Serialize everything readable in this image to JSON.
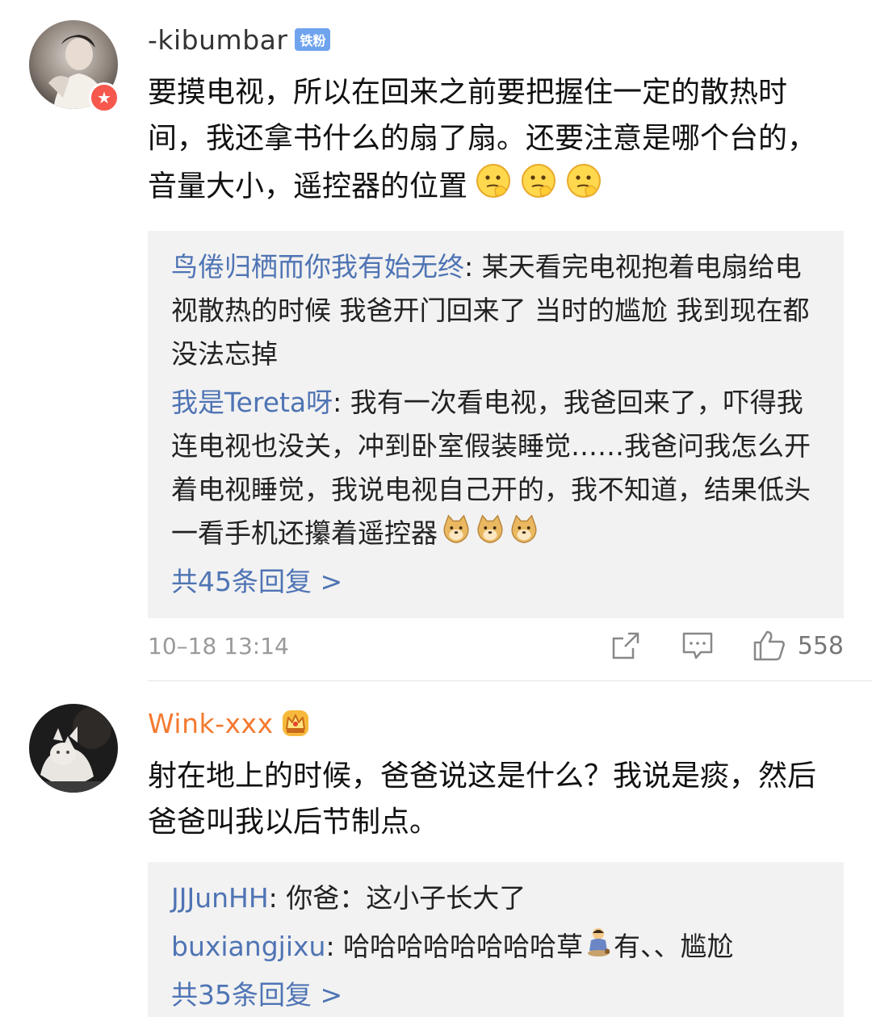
{
  "comments": [
    {
      "username": "-kibumbar",
      "fan_badge": "铁粉",
      "avatar_icon": "avatar-photo-woman",
      "badge_icon": "vip-star-icon",
      "text": "要摸电视，所以在回来之前要把握住一定的散热时间，我还拿书什么的扇了扇。还要注意是哪个台的，音量大小，遥控器的位置",
      "text_emoji": "thinking-face-emoji",
      "replies": [
        {
          "user": "鸟倦归栖而你我有始无终",
          "sep": ": ",
          "text": "某天看完电视抱着电扇给电视散热的时候 我爸开门回来了 当时的尴尬 我到现在都没法忘掉"
        },
        {
          "user": "我是Tereta呀",
          "sep": ": ",
          "text": "我有一次看电视，我爸回来了，吓得我连电视也没关，冲到卧室假装睡觉……我爸问我怎么开着电视睡觉，我说电视自己开的，我不知道，结果低头一看手机还攥着遥控器",
          "emoji": "doge-emoji"
        }
      ],
      "more_replies": "共45条回复 >",
      "timestamp": "10–18 13:14",
      "like_count": "558"
    },
    {
      "username": "Wink-xxx",
      "avatar_icon": "avatar-photo-cat",
      "crown_icon": "crown-icon",
      "text": "射在地上的时候，爸爸说这是什么？我说是痰，然后爸爸叫我以后节制点。",
      "replies": [
        {
          "user": "JJJunHH",
          "sep": ": ",
          "text": "你爸：这小子长大了"
        },
        {
          "user": "buxiangjixu",
          "sep": ": ",
          "text": "哈哈哈哈哈哈哈哈草",
          "emoji": "pooping-figure-emoji",
          "text_after": "有、、尴尬"
        }
      ],
      "more_replies": "共35条回复 >"
    }
  ],
  "colors": {
    "link_blue": "#4f74b4",
    "vip_orange": "#f47a30",
    "fan_badge_blue": "#6fa3ee",
    "reply_bg": "#f2f2f2",
    "meta_gray": "#9a9a9a"
  }
}
